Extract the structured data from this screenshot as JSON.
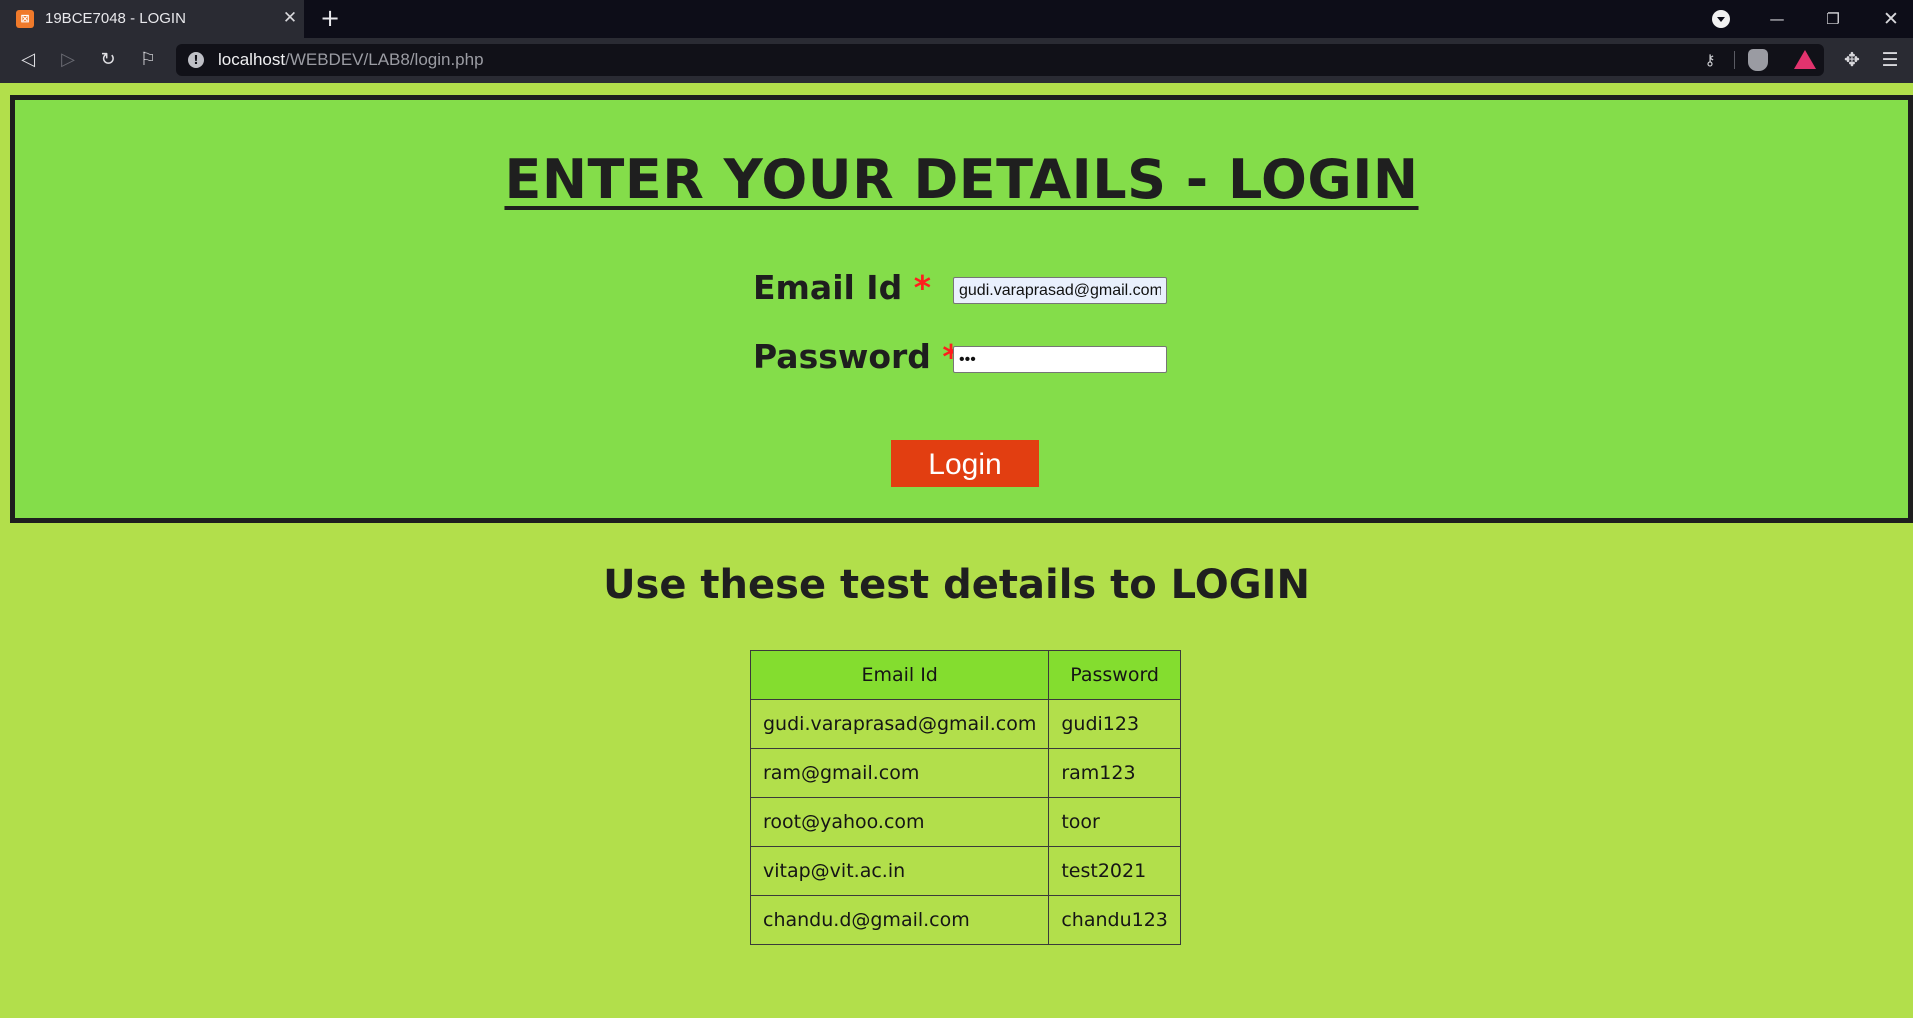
{
  "browser": {
    "tab_title": "19BCE7048 - LOGIN",
    "tab_favicon": "xampp-icon",
    "url_host": "localhost",
    "url_path": "/WEBDEV/LAB8/login.php"
  },
  "page": {
    "title": "ENTER YOUR DETAILS - LOGIN",
    "email_label": "Email Id",
    "password_label": "Password",
    "required_mark": "*",
    "email_value": "gudi.varaprasad@gmail.com",
    "password_value": "•••",
    "login_button": "Login",
    "test_heading": "Use these test details to LOGIN",
    "colors": {
      "panel_bg": "#84dd4a",
      "page_bg": "#b2df4b",
      "button_bg": "#e23e11",
      "required": "#ff1d1d"
    }
  },
  "test_table": {
    "headers": [
      "Email Id",
      "Password"
    ],
    "rows": [
      [
        "gudi.varaprasad@gmail.com",
        "gudi123"
      ],
      [
        "ram@gmail.com",
        "ram123"
      ],
      [
        "root@yahoo.com",
        "toor"
      ],
      [
        "vitap@vit.ac.in",
        "test2021"
      ],
      [
        "chandu.d@gmail.com",
        "chandu123"
      ]
    ]
  }
}
